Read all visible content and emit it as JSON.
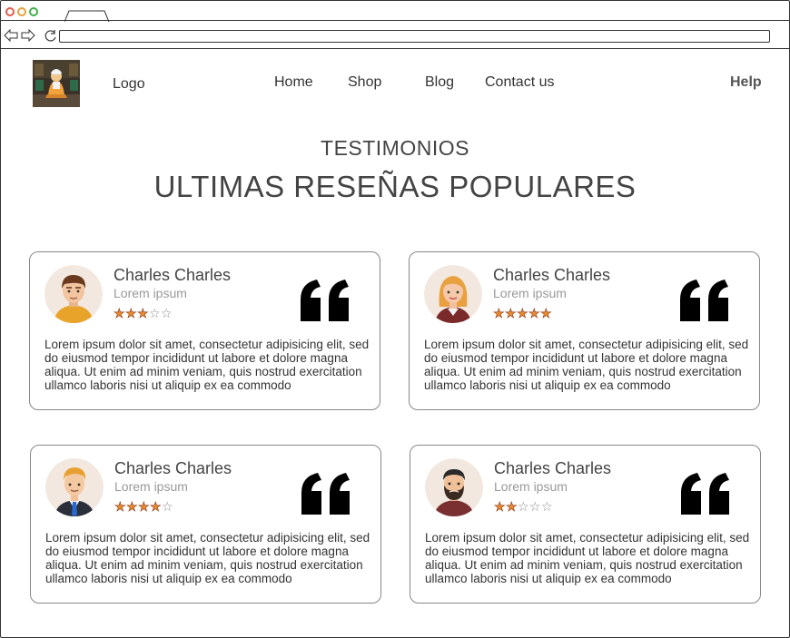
{
  "browser": {
    "window_controls": [
      "close",
      "minimize",
      "maximize"
    ],
    "url": ""
  },
  "header": {
    "logo_label": "Logo",
    "nav": [
      "Home",
      "Shop",
      "Blog",
      "Contact us"
    ],
    "help": "Help"
  },
  "section": {
    "subtitle": "TESTIMONIOS",
    "title": "ULTIMAS RESEÑAS POPULARES"
  },
  "testimonials": [
    {
      "name": "Charles Charles",
      "subtitle": "Lorem ipsum",
      "rating": 3,
      "max_rating": 5,
      "text": "Lorem ipsum dolor sit amet, consectetur adipisicing elit, sed do eiusmod tempor incididunt ut labore et dolore magna aliqua. Ut enim ad minim veniam, quis nostrud exercitation ullamco laboris nisi ut aliquip ex ea commodo",
      "avatar": "man-brown-hair-avatar"
    },
    {
      "name": "Charles Charles",
      "subtitle": "Lorem ipsum",
      "rating": 5,
      "max_rating": 5,
      "text": "Lorem ipsum dolor sit amet, consectetur adipisicing elit, sed do eiusmod tempor incididunt ut labore et dolore magna aliqua. Ut enim ad minim veniam, quis nostrud exercitation ullamco laboris nisi ut aliquip ex ea commodo",
      "avatar": "woman-blonde-avatar"
    },
    {
      "name": "Charles Charles",
      "subtitle": "Lorem ipsum",
      "rating": 4,
      "max_rating": 5,
      "text": "Lorem ipsum dolor sit amet, consectetur adipisicing elit, sed do eiusmod tempor incididunt ut labore et dolore magna aliqua. Ut enim ad minim veniam, quis nostrud exercitation ullamco laboris nisi ut aliquip ex ea commodo",
      "avatar": "man-suit-tie-avatar"
    },
    {
      "name": "Charles Charles",
      "subtitle": "Lorem ipsum",
      "rating": 2,
      "max_rating": 5,
      "text": "Lorem ipsum dolor sit amet, consectetur adipisicing elit, sed do eiusmod tempor incididunt ut labore et dolore magna aliqua. Ut enim ad minim veniam, quis nostrud exercitation ullamco laboris nisi ut aliquip ex ea commodo",
      "avatar": "man-beard-avatar"
    }
  ],
  "colors": {
    "star_fill": "#e88a2e",
    "text": "#333333",
    "muted": "#999999",
    "card_border": "#888888"
  }
}
